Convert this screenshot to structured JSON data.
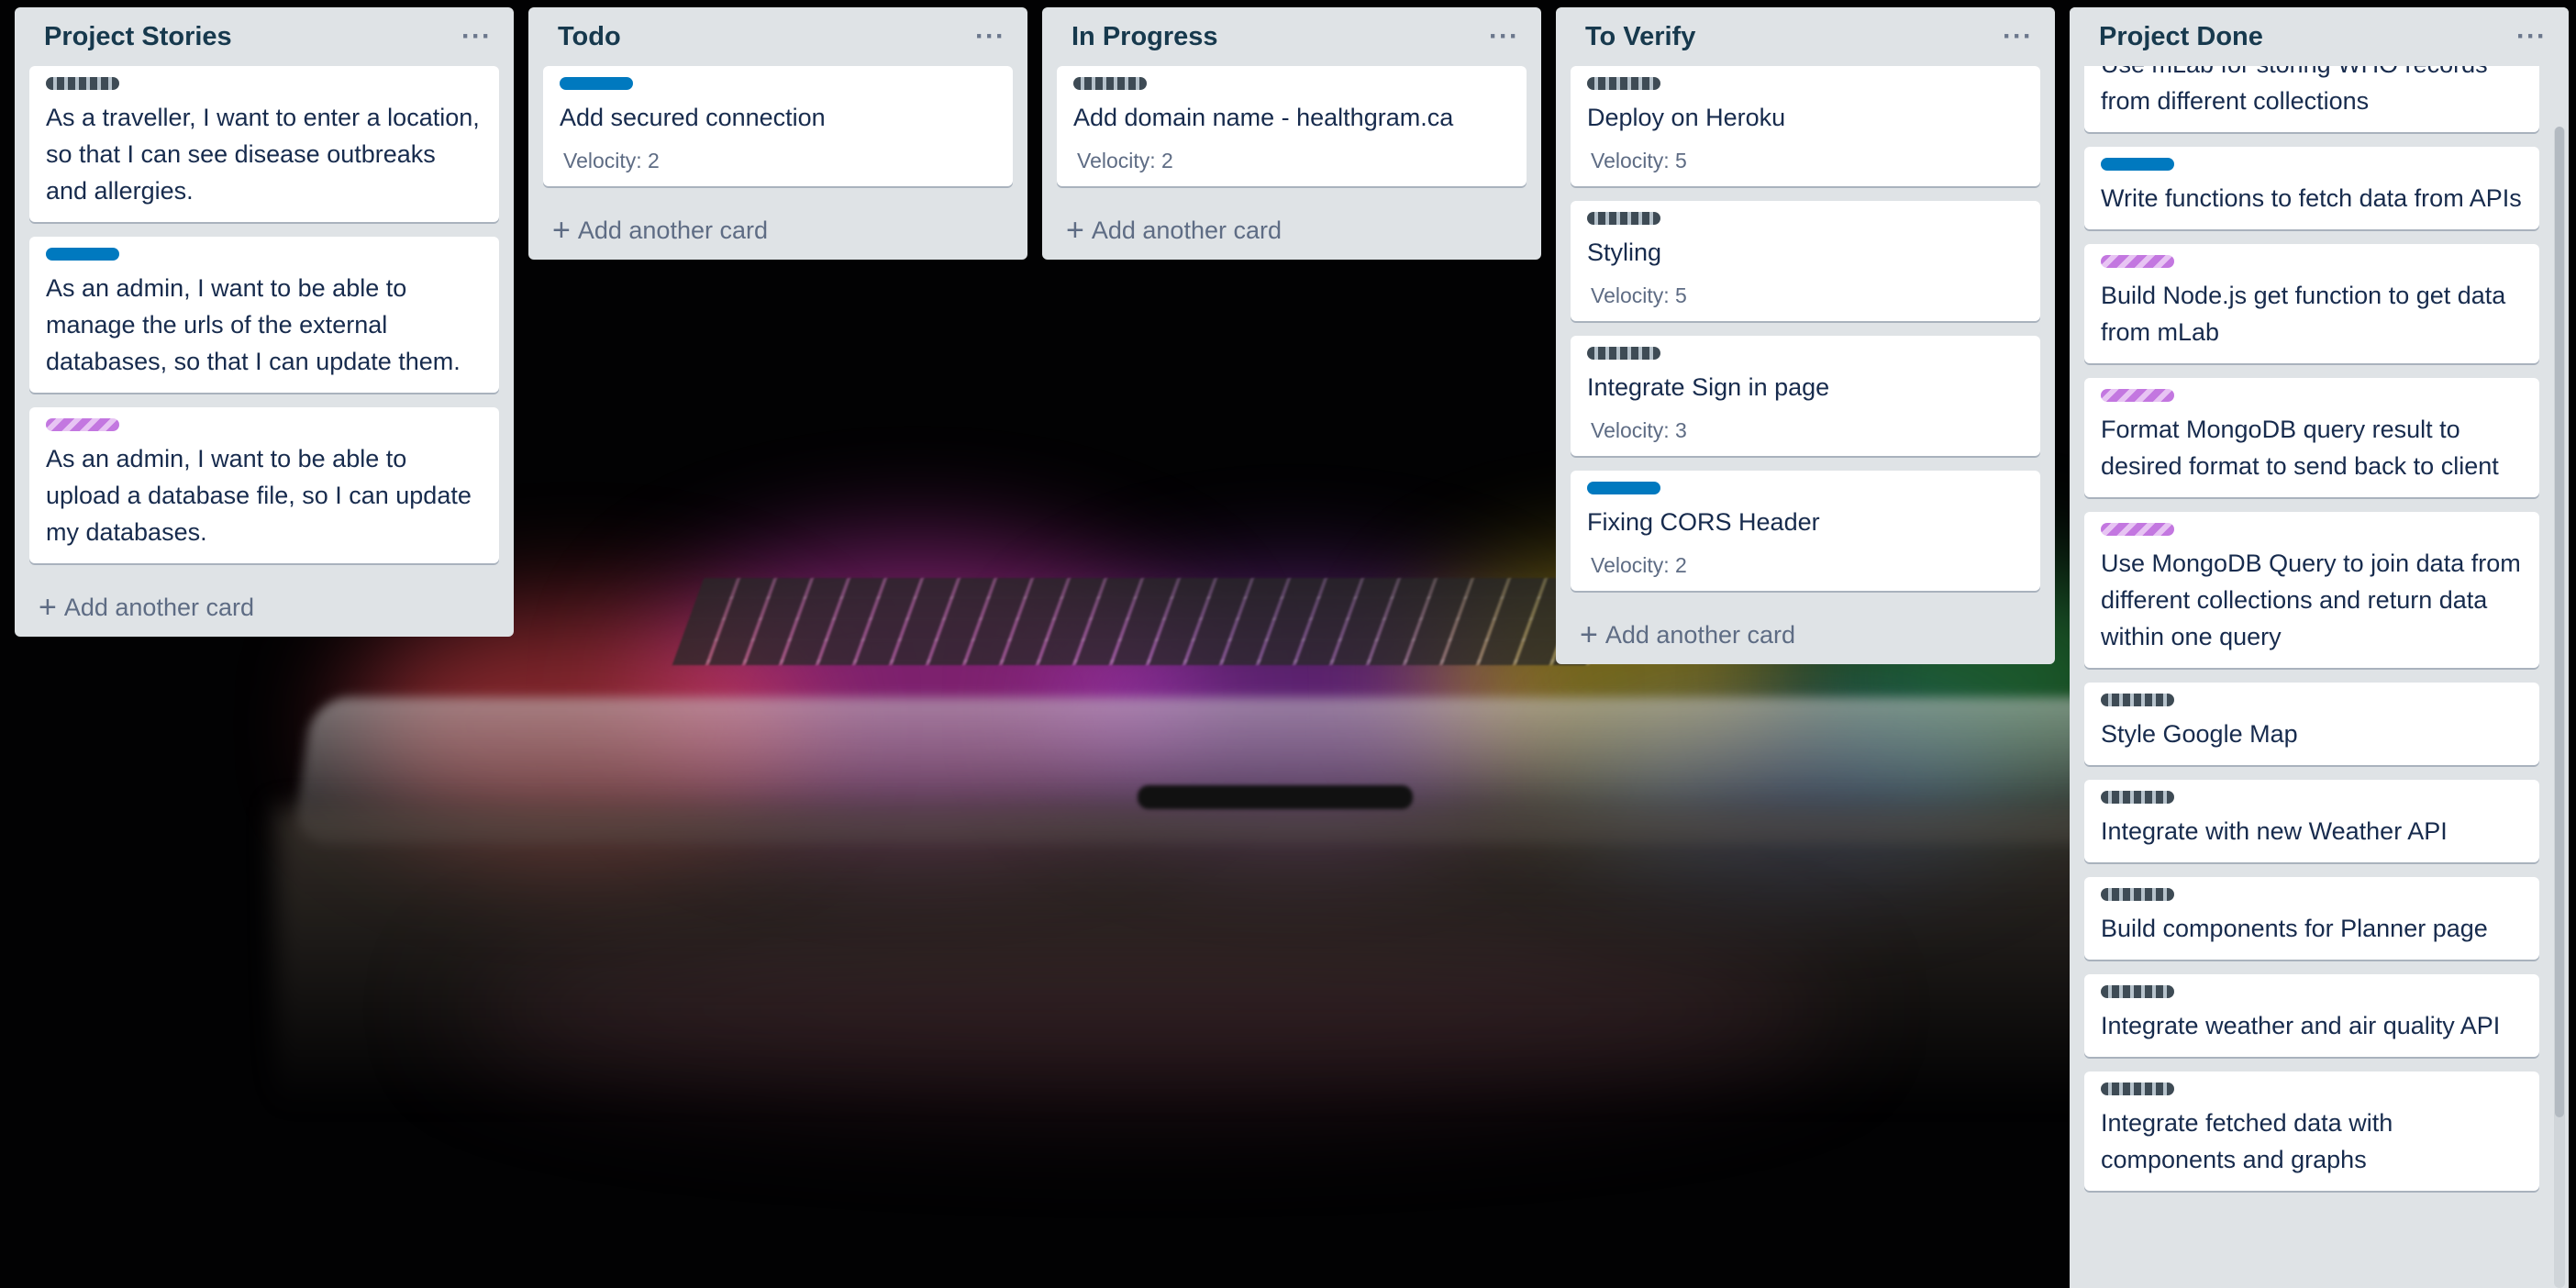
{
  "lists": [
    {
      "title": "Project Stories",
      "add_label": "Add another card",
      "cards": [
        {
          "label": "gray",
          "text": "As a traveller, I want to enter a location, so that I can see disease outbreaks and allergies."
        },
        {
          "label": "blue",
          "text": "As an admin, I want to be able to manage the urls of the external databases, so that I can update them."
        },
        {
          "label": "purple",
          "text": "As an admin, I want to be able to upload a database file, so I can update my databases."
        }
      ]
    },
    {
      "title": "Todo",
      "add_label": "Add another card",
      "cards": [
        {
          "label": "blue",
          "text": "Add secured connection",
          "velocity": "Velocity: 2"
        }
      ]
    },
    {
      "title": "In Progress",
      "add_label": "Add another card",
      "cards": [
        {
          "label": "gray",
          "text": "Add domain name - healthgram.ca",
          "velocity": "Velocity: 2"
        }
      ]
    },
    {
      "title": "To Verify",
      "add_label": "Add another card",
      "cards": [
        {
          "label": "gray",
          "text": "Deploy on Heroku",
          "velocity": "Velocity: 5"
        },
        {
          "label": "gray",
          "text": "Styling",
          "velocity": "Velocity: 5"
        },
        {
          "label": "gray",
          "text": "Integrate Sign in page",
          "velocity": "Velocity: 3"
        },
        {
          "label": "blue",
          "text": "Fixing CORS Header",
          "velocity": "Velocity: 2"
        }
      ]
    },
    {
      "title": "Project Done",
      "cards": [
        {
          "text": "Use mLab for storing WHO records from different collections"
        },
        {
          "label": "blue",
          "text": "Write functions to fetch data from APIs"
        },
        {
          "label": "purple",
          "text": "Build Node.js get function to get data from mLab"
        },
        {
          "label": "purple",
          "text": "Format MongoDB query result to desired format to send back to client"
        },
        {
          "label": "purple",
          "text": "Use MongoDB Query to join data from different collections and return data within one query"
        },
        {
          "label": "gray",
          "text": "Style Google Map"
        },
        {
          "label": "gray",
          "text": "Integrate with new Weather API"
        },
        {
          "label": "gray",
          "text": "Build components for Planner page"
        },
        {
          "label": "gray",
          "text": "Integrate weather and air quality API"
        },
        {
          "label": "gray",
          "text": "Integrate fetched data with components and graphs"
        }
      ]
    }
  ],
  "menu_glyph": "···",
  "plus_glyph": "+",
  "colors": {
    "list_bg": "#dfe3e6",
    "label_blue": "#0079bf",
    "label_purple": "#c377e0",
    "label_gray": "#3e4b55",
    "title_color": "#17394d"
  }
}
